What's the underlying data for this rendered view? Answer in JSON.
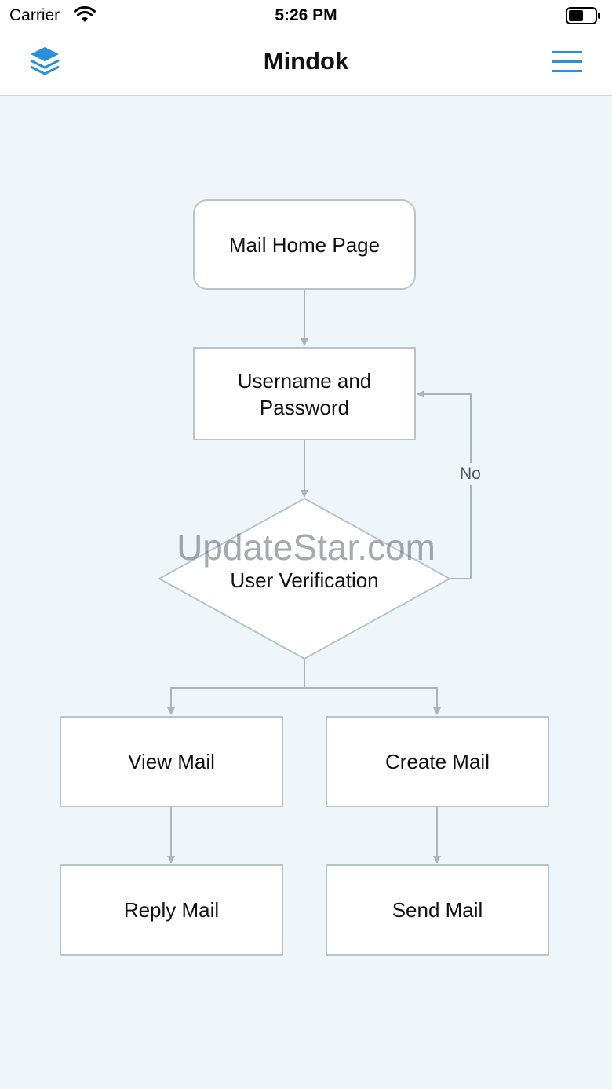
{
  "status_bar": {
    "carrier": "Carrier",
    "time": "5:26 PM"
  },
  "nav": {
    "title": "Mindok",
    "left_icon": "layers-icon",
    "right_icon": "menu-icon",
    "accent_color": "#2a8fd6"
  },
  "flowchart": {
    "nodes": {
      "home": "Mail Home Page",
      "login": "Username and\nPassword",
      "verify": "User Verification",
      "view": "View Mail",
      "create": "Create Mail",
      "reply": "Reply Mail",
      "send": "Send Mail"
    },
    "edge_labels": {
      "no": "No"
    }
  },
  "watermark": "UpdateStar.com"
}
